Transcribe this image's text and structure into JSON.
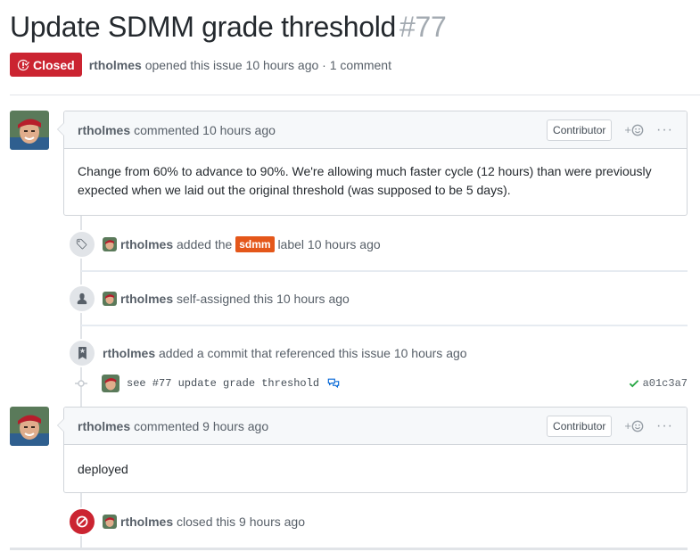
{
  "issue": {
    "title": "Update SDMM grade threshold",
    "number": "#77",
    "state": "Closed",
    "author": "rtholmes",
    "meta_text": "opened this issue 10 hours ago · 1 comment"
  },
  "comments": [
    {
      "author": "rtholmes",
      "time": "commented 10 hours ago",
      "role": "Contributor",
      "body": "Change from 60% to advance to 90%. We're allowing much faster cycle (12 hours) than were previously expected when we laid out the original threshold (was supposed to be 5 days)."
    },
    {
      "author": "rtholmes",
      "time": "commented 9 hours ago",
      "role": "Contributor",
      "body": "deployed"
    }
  ],
  "events": {
    "label": {
      "actor": "rtholmes",
      "pre": "added the",
      "label_name": "sdmm",
      "post": "label 10 hours ago",
      "label_color": "#e4571a"
    },
    "assign": {
      "actor": "rtholmes",
      "text": "self-assigned this 10 hours ago"
    },
    "commit_ref": {
      "actor": "rtholmes",
      "text": "added a commit that referenced this issue 10 hours ago"
    },
    "commit": {
      "message": "see #77 update grade threshold",
      "sha": "a01c3a7"
    },
    "closed": {
      "actor": "rtholmes",
      "text": "closed this 9 hours ago"
    }
  },
  "reaction_glyph": "+",
  "more_glyph": "···",
  "icons": [
    "issue-closed-icon",
    "tag-icon",
    "person-icon",
    "bookmark-icon",
    "git-commit-icon",
    "comment-discussion-icon",
    "check-icon",
    "circle-slash-icon",
    "smiley-icon",
    "kebab-icon"
  ],
  "colors": {
    "closed_red": "#cb2431",
    "success_green": "#28a745",
    "muted": "#586069"
  }
}
